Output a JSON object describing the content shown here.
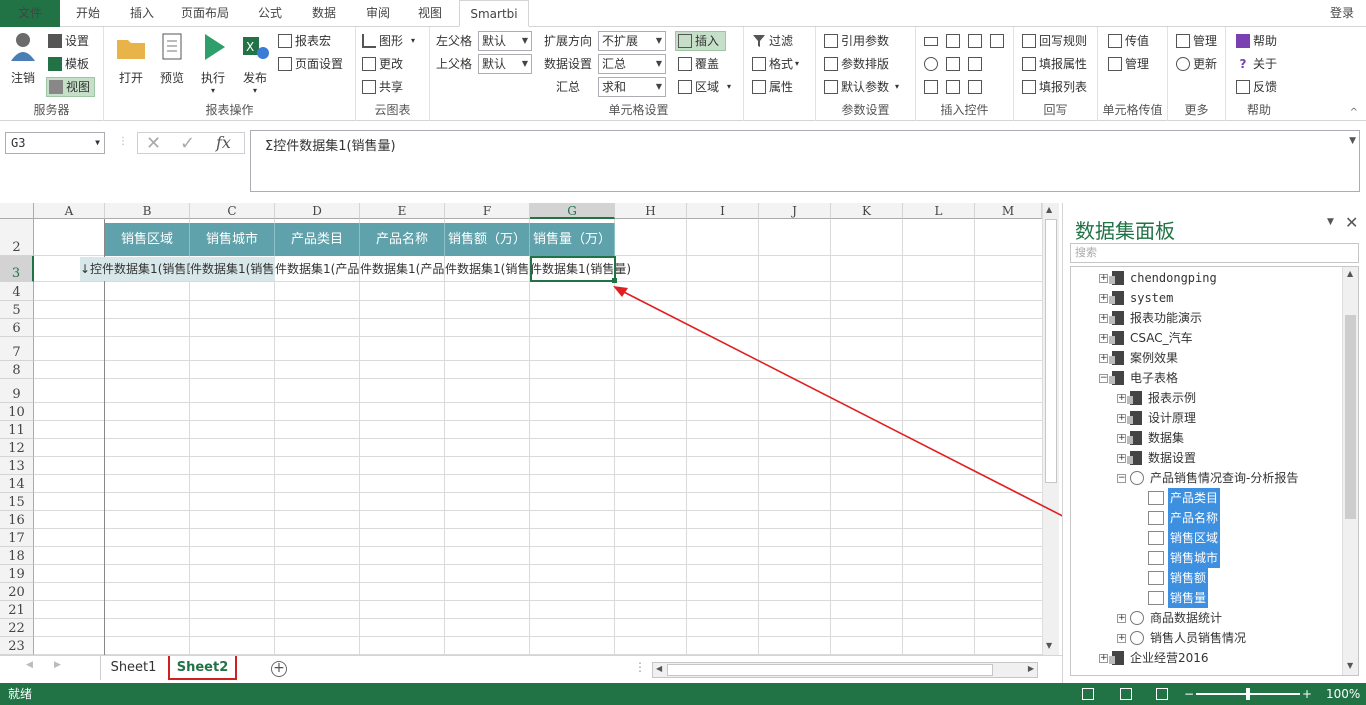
{
  "tabs": {
    "file": "文件",
    "home": "开始",
    "insert": "插入",
    "layout": "页面布局",
    "formula": "公式",
    "data": "数据",
    "review": "审阅",
    "view": "视图",
    "smartbi": "Smartbi",
    "login": "登录"
  },
  "ribbon": {
    "server": {
      "login": "注销",
      "settings": "设置",
      "template": "模板",
      "view": "视图",
      "label": "服务器"
    },
    "report_ops": {
      "open": "打开",
      "preview": "预览",
      "run": "执行",
      "publish": "发布",
      "macro": "报表宏",
      "page_setup": "页面设置",
      "label": "报表操作"
    },
    "cloud": {
      "chart": "图形",
      "update": "更改",
      "share": "共享",
      "label": "云图表"
    },
    "parent": {
      "left_label": "左父格",
      "left_value": "默认",
      "top_label": "上父格",
      "top_value": "默认"
    },
    "cell": {
      "expand_label": "扩展方向",
      "expand_value": "不扩展",
      "dataset_label": "数据设置",
      "dataset_value": "汇总",
      "sum_label": "汇总",
      "sum_value": "求和",
      "insert": "插入",
      "cover": "覆盖",
      "region": "区域",
      "label": "单元格设置"
    },
    "filter": {
      "filter": "过滤",
      "format": "格式",
      "attr": "属性"
    },
    "params": {
      "ref": "引用参数",
      "layout": "参数排版",
      "default": "默认参数",
      "label": "参数设置"
    },
    "controls": {
      "label": "插入控件"
    },
    "writeback": {
      "rule": "回写规则",
      "fill_attr": "填报属性",
      "fill_list": "填报列表",
      "label": "回写"
    },
    "cellpass": {
      "pass": "传值",
      "manage": "管理",
      "label": "单元格传值"
    },
    "more": {
      "manage": "管理",
      "update": "更新",
      "label": "更多"
    },
    "help": {
      "help": "帮助",
      "about": "关于",
      "feedback": "反馈",
      "label": "帮助"
    }
  },
  "formula_bar": {
    "cell_ref": "G3",
    "formula": "Σ控件数据集1(销售量)"
  },
  "sheet": {
    "columns": [
      "A",
      "B",
      "C",
      "D",
      "E",
      "F",
      "G",
      "H",
      "I",
      "J",
      "K",
      "L",
      "M"
    ],
    "rows": [
      "2",
      "3",
      "4",
      "5",
      "6",
      "7",
      "8",
      "9",
      "10",
      "11",
      "12",
      "13",
      "14",
      "15",
      "16",
      "17",
      "18",
      "19",
      "20",
      "21",
      "22",
      "23"
    ],
    "headers": [
      "销售区域",
      "销售城市",
      "产品类目",
      "产品名称",
      "销售额（万）",
      "销售量（万）"
    ],
    "row3": [
      "↓控件数据集1(销售区",
      "件数据集1(销售城",
      "件数据集1(产品类",
      "件数据集1(产品名",
      "件数据集1(销售额",
      "件数据集1(销售量)"
    ]
  },
  "sheet_tabs": {
    "sheet1": "Sheet1",
    "sheet2": "Sheet2"
  },
  "status": {
    "ready": "就绪",
    "zoom": "100%"
  },
  "panel": {
    "title": "数据集面板",
    "search_placeholder": "搜索",
    "tree": [
      "chendongping",
      "system",
      "报表功能演示",
      "CSAC_汽车",
      "案例效果",
      "电子表格",
      "报表示例",
      "设计原理",
      "数据集",
      "数据设置",
      "产品销售情况查询-分析报告",
      "产品类目",
      "产品名称",
      "销售区域",
      "销售城市",
      "销售额",
      "销售量",
      "商品数据统计",
      "销售人员销售情况",
      "企业经营2016"
    ]
  }
}
